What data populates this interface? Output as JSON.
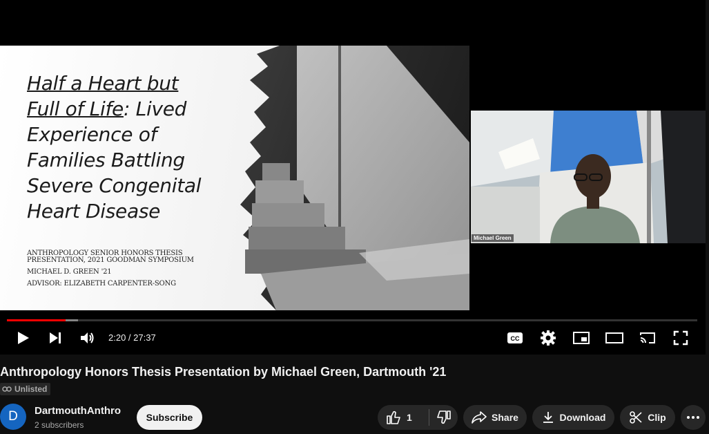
{
  "slide": {
    "title_line1": "Half a Heart but",
    "title_line2_underlined": "Full of Life",
    "title_line2_rest": ": Lived",
    "title_line3": "Experience of",
    "title_line4": "Families Battling",
    "title_line5": "Severe Congenital",
    "title_line6": "Heart Disease",
    "meta_line1": "ANTHROPOLOGY SENIOR HONORS THESIS",
    "meta_line2": "PRESENTATION, 2021 GOODMAN SYMPOSIUM",
    "meta_author": "MICHAEL D. GREEN '21",
    "meta_advisor": "ADVISOR: ELIZABETH CARPENTER-SONG"
  },
  "camera": {
    "participant_name": "Michael Green"
  },
  "player": {
    "time_display": "2:20 / 27:37",
    "progress_played": 0.085,
    "progress_buffered": 0.103,
    "icons": [
      "play-icon",
      "next-icon",
      "volume-icon",
      "captions-icon",
      "settings-icon",
      "miniplayer-icon",
      "theater-icon",
      "cast-icon",
      "fullscreen-icon"
    ]
  },
  "video": {
    "title": "Anthropology Honors Thesis Presentation by Michael Green, Dartmouth '21",
    "visibility": "Unlisted"
  },
  "channel": {
    "avatar_letter": "D",
    "name": "DartmouthAnthro",
    "subscribers": "2 subscribers",
    "subscribe_label": "Subscribe",
    "avatar_color": "#1565c0"
  },
  "actions": {
    "like_count": "1",
    "share_label": "Share",
    "download_label": "Download",
    "clip_label": "Clip"
  },
  "colors": {
    "accent": "#ff0000",
    "background": "#0f0f0f",
    "pill": "#272727"
  }
}
